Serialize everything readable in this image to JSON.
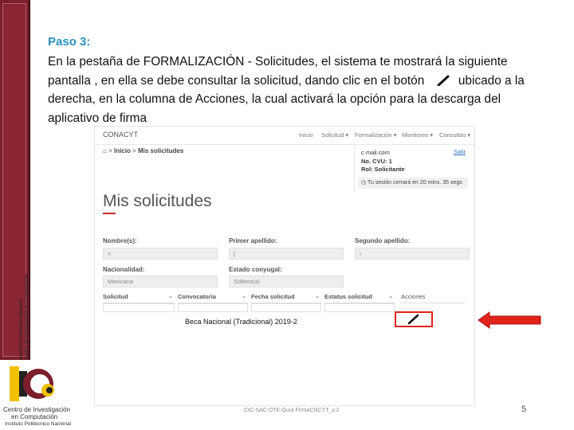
{
  "sidebar": {
    "line1": "Instituto Politécnico Nacional",
    "line2": "Centro de Investigación en Computación"
  },
  "slide": {
    "step_title": "Paso 3:",
    "body_part1": "En la pestaña de FORMALIZACIÓN - Solicitudes, el sistema te mostrará la siguiente pantalla , en ella se debe consultar la solicitud, dando clic en el botón",
    "body_part2": "ubicado a la derecha, en la columna de Acciones, la cual activará la opción para la descarga del aplicativo de firma"
  },
  "screenshot": {
    "brand": "CONACYT",
    "nav": [
      "Inicio",
      "Solicitud ▾",
      "Formalización ▾",
      "Monitoreo ▾",
      "Consultas ▾"
    ],
    "breadcrumb_home": "Inicio",
    "breadcrumb_current": "Mis solicitudes",
    "user": {
      "email": "c                    mail.com",
      "logout": "Salir",
      "cvu": "No. CVU: 1",
      "role": "Rol: Solicitante",
      "timer": "Tu sesión cerrará en 20 mins. 35 segs"
    },
    "page_title": "Mis solicitudes",
    "fields": {
      "nombre_label": "Nombre(s):",
      "nombre_value": "<",
      "primer_apellido_label": "Primer apellido:",
      "primer_apellido_value": "[",
      "segundo_apellido_label": "Segundo apellido:",
      "segundo_apellido_value": "›",
      "nacionalidad_label": "Nacionalidad:",
      "nacionalidad_value": "Mexicana",
      "estado_label": "Estado conyugal:",
      "estado_value": "Soltero(a)"
    },
    "table": {
      "headers": [
        "Solicitud",
        "Convocatoria",
        "Fecha solicitud",
        "Estatus solicitud",
        "Acciones"
      ],
      "row": "Beca Nacional (Tradicional) 2019-2"
    }
  },
  "footer": {
    "institution_line1": "Centro de Investigación",
    "institution_line2": "en Computación",
    "institution_line3": "Instituto Politécnico Nacional",
    "doc_name": "CIC-SAC-DTE-Guía FirmaCNCYT_v.2",
    "page_number": "5"
  },
  "colors": {
    "step_title": "#2a8fbf",
    "sidebar": "#7a1f2b",
    "highlight": "#e0231b",
    "arrow": "#e0231b"
  }
}
